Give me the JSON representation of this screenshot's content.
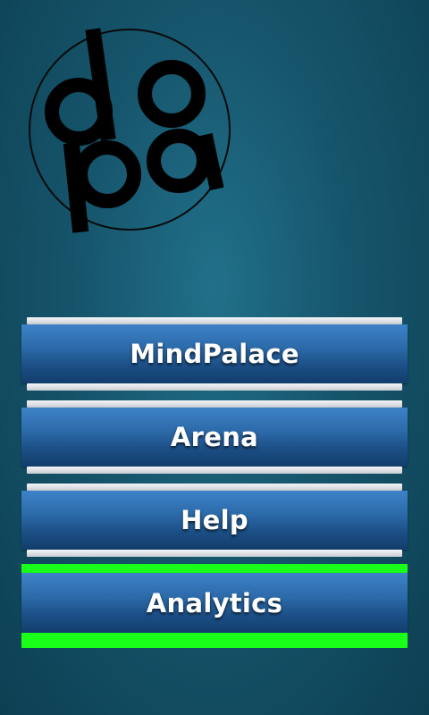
{
  "logo": {
    "icon": "dopa-logo-icon",
    "text": "dopa"
  },
  "menu": {
    "items": [
      {
        "label": "MindPalace"
      },
      {
        "label": "Arena"
      },
      {
        "label": "Help"
      },
      {
        "label": "Analytics"
      }
    ],
    "selected_index": 3
  },
  "colors": {
    "background": "#16556c",
    "button_blue": "#2c6aa9",
    "selected_highlight": "#1aff1a"
  }
}
